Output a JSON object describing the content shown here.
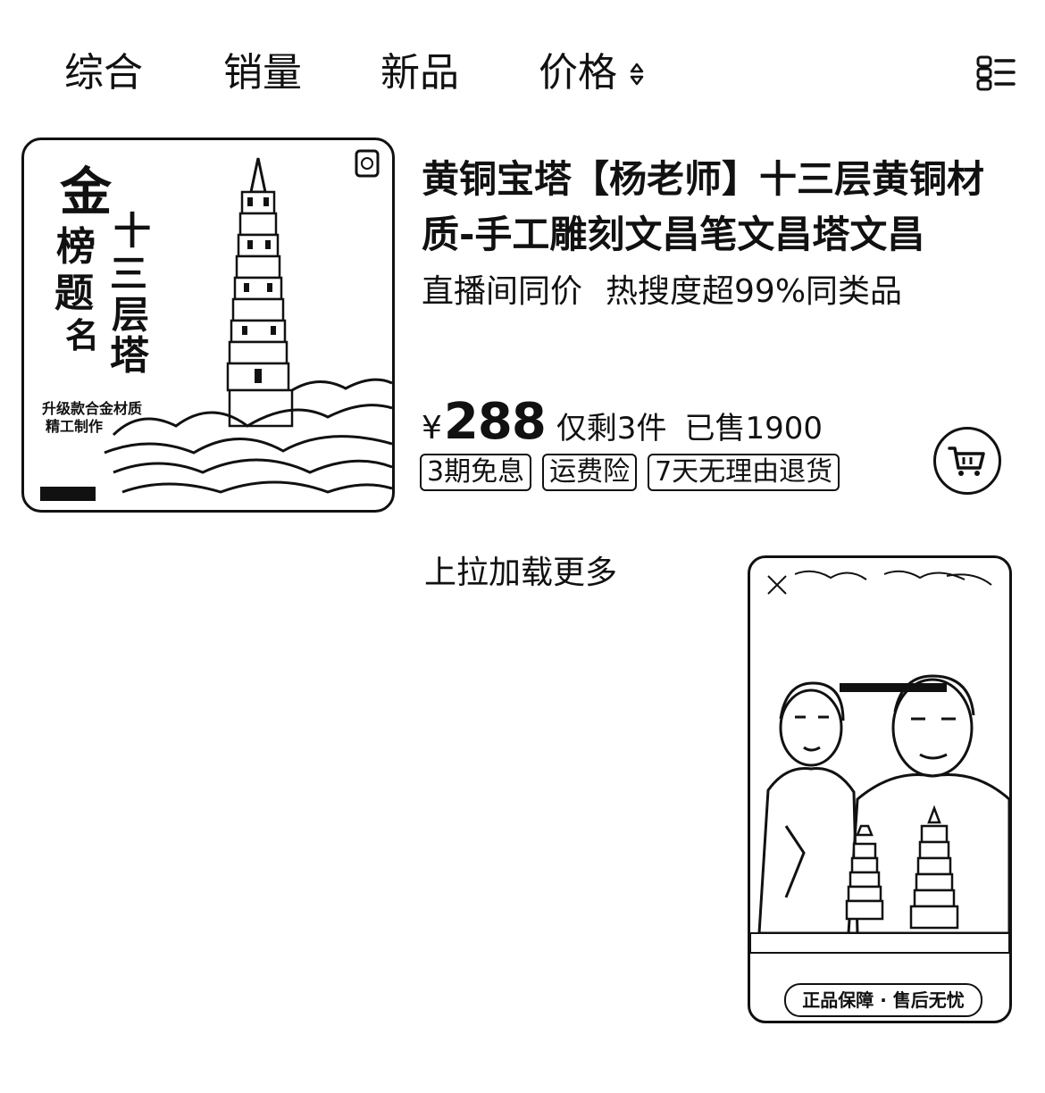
{
  "sort_bar": {
    "tabs": [
      {
        "label": "综合"
      },
      {
        "label": "销量"
      },
      {
        "label": "新品"
      },
      {
        "label": "价格"
      }
    ]
  },
  "product": {
    "title": "黄铜宝塔【杨老师】十三层黄铜材质-手工雕刻文昌笔文昌塔文昌",
    "promo": [
      "直播间同价",
      "热搜度超99%同类品"
    ],
    "price": {
      "currency": "¥",
      "value": "288",
      "stock": "仅剩3件",
      "sold": "已售1900"
    },
    "tags": [
      "3期免息",
      "运费险",
      "7天无理由退货"
    ],
    "image": {
      "title_left": "金榜题名",
      "title_right": "十三层塔",
      "caption": "升级款合金材质",
      "caption2": "精工制作"
    }
  },
  "load_more": "上拉加载更多",
  "live_window": {
    "footer_badge": "正品保障 · 售后无忧"
  },
  "colors": {
    "text": "#111111",
    "background": "#ffffff"
  },
  "icons": {
    "sort": "sort-updown-icon",
    "layout": "list-layout-icon",
    "cart": "shopping-cart-icon"
  }
}
